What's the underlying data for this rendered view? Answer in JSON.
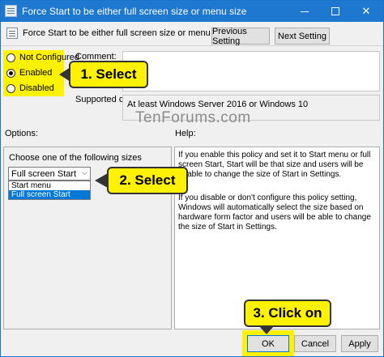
{
  "window": {
    "title": "Force Start to be either full screen size or menu size",
    "controls": {
      "minimize": "minimize",
      "maximize": "maximize",
      "close": "✕"
    }
  },
  "header": {
    "policy_title": "Force Start to be either full screen size or menu size",
    "prev_button": "Previous Setting",
    "next_button": "Next Setting"
  },
  "state": {
    "options": [
      {
        "label": "Not Configured",
        "selected": false
      },
      {
        "label": "Enabled",
        "selected": true
      },
      {
        "label": "Disabled",
        "selected": false
      }
    ]
  },
  "comment": {
    "label": "Comment:",
    "value": ""
  },
  "supported": {
    "label": "Supported on:",
    "value": "At least Windows Server 2016 or Windows 10"
  },
  "watermark": "TenForums.com",
  "options_pane": {
    "label": "Options:",
    "caption": "Choose one of the following sizes",
    "combo_value": "Full screen Start",
    "dropdown_items": [
      "Start menu",
      "Full screen Start"
    ],
    "highlighted_index": 1
  },
  "help_pane": {
    "label": "Help:",
    "paragraphs": [
      "If you enable this policy and set it to Start menu or full screen Start, Start will be that size and users will be unable to change the size of Start in Settings.",
      "If you disable or don't configure this policy setting, Windows will automatically select the size based on hardware form factor and users will be able to change the size of Start in Settings."
    ]
  },
  "footer": {
    "ok": "OK",
    "cancel": "Cancel",
    "apply": "Apply"
  },
  "callouts": [
    "1. Select",
    "2. Select",
    "3. Click on"
  ],
  "colors": {
    "titlebar": "#1e78d0",
    "highlight": "#fff200",
    "selection": "#0078d7"
  },
  "icons": {
    "app": "policy-document-icon",
    "chevron": "chevron-down-icon"
  }
}
